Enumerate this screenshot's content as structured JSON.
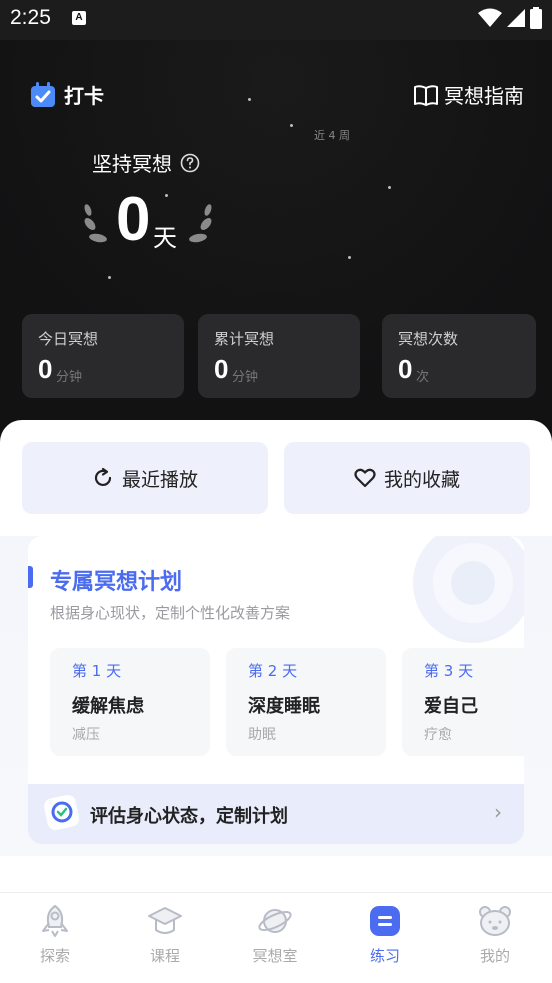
{
  "status_bar": {
    "time": "2:25",
    "notif_letter": "A"
  },
  "header": {
    "checkin_label": "打卡",
    "guide_label": "冥想指南"
  },
  "hero": {
    "recent_weeks": "近 4 周",
    "persist_label": "坚持冥想",
    "days_value": "0",
    "days_unit": "天"
  },
  "stats": [
    {
      "title": "今日冥想",
      "value": "0",
      "unit": "分钟"
    },
    {
      "title": "累计冥想",
      "value": "0",
      "unit": "分钟"
    },
    {
      "title": "冥想次数",
      "value": "0",
      "unit": "次"
    }
  ],
  "quick": {
    "recent_play": "最近播放",
    "favorites": "我的收藏"
  },
  "plan": {
    "title": "专属冥想计划",
    "subtitle": "根据身心现状，定制个性化改善方案",
    "days": [
      {
        "label": "第 1 天",
        "title": "缓解焦虑",
        "tag": "减压"
      },
      {
        "label": "第 2 天",
        "title": "深度睡眠",
        "tag": "助眠"
      },
      {
        "label": "第 3 天",
        "title": "爱自己",
        "tag": "疗愈"
      }
    ],
    "assess_label": "评估身心状态，定制计划",
    "assess_arrow": "›"
  },
  "tabs": [
    {
      "label": "探索",
      "icon": "rocket-icon"
    },
    {
      "label": "课程",
      "icon": "graduation-cap-icon"
    },
    {
      "label": "冥想室",
      "icon": "planet-icon"
    },
    {
      "label": "练习",
      "icon": "practice-icon"
    },
    {
      "label": "我的",
      "icon": "bear-icon"
    }
  ],
  "active_tab": "练习",
  "colors": {
    "accent": "#4b6cf1",
    "hero_bg": "#141415",
    "card_bg": "#2a2a2c"
  }
}
